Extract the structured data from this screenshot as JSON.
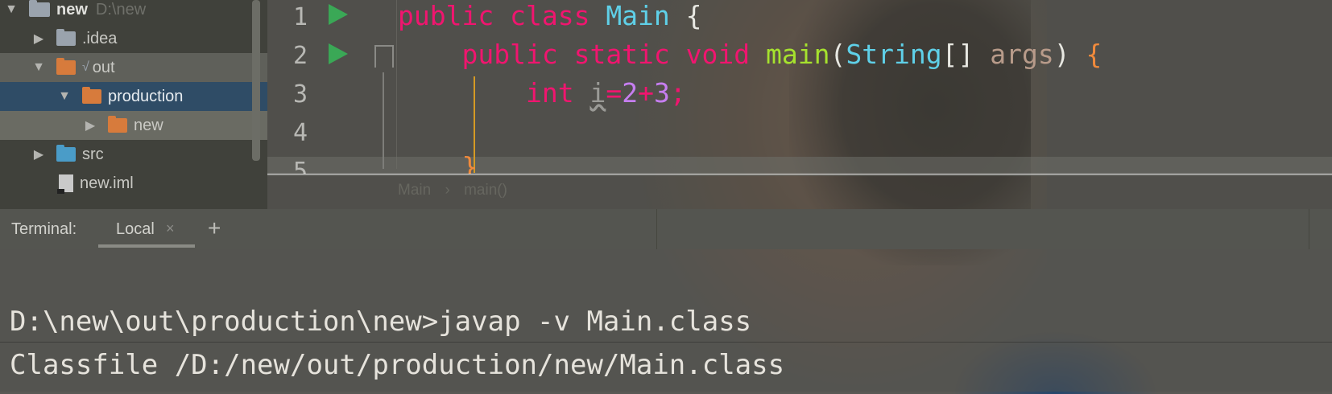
{
  "project_tree": {
    "root": {
      "name": "new",
      "path": "D:\\new"
    },
    "items": [
      {
        "label": ".idea",
        "level": 1,
        "expanded": false,
        "icon": "folder-grey"
      },
      {
        "label": "out",
        "level": 1,
        "expanded": true,
        "icon": "folder-orange"
      },
      {
        "label": "production",
        "level": 2,
        "expanded": true,
        "icon": "folder-orange"
      },
      {
        "label": "new",
        "level": 3,
        "expanded": false,
        "icon": "folder-orange"
      },
      {
        "label": "src",
        "level": 1,
        "expanded": false,
        "icon": "folder-blue"
      },
      {
        "label": "new.iml",
        "level": 1,
        "icon": "module-file"
      }
    ]
  },
  "editor": {
    "line_numbers": [
      "1",
      "2",
      "3",
      "4",
      "5"
    ],
    "lines": {
      "l1": {
        "kw1": "public",
        "kw2": "class",
        "name": "Main",
        "brace": "{"
      },
      "l2": {
        "kw1": "public",
        "kw2": "static",
        "kw3": "void",
        "fn": "main",
        "open": "(",
        "type": "String",
        "arr": "[]",
        "param": "args",
        "close": ")",
        "brace": "{"
      },
      "l3": {
        "type": "int",
        "var": "i",
        "eq": "=",
        "n1": "2",
        "plus": "+",
        "n2": "3",
        "semi": ";"
      },
      "l5": {
        "brace": "}"
      }
    },
    "breadcrumb": {
      "class": "Main",
      "sep": "›",
      "method": "main()"
    }
  },
  "terminal": {
    "label": "Terminal:",
    "tab_label": "Local",
    "close_glyph": "×",
    "add_glyph": "+",
    "lines": [
      "D:\\new\\out\\production\\new>javap -v Main.class",
      "Classfile /D:/new/out/production/new/Main.class"
    ]
  }
}
